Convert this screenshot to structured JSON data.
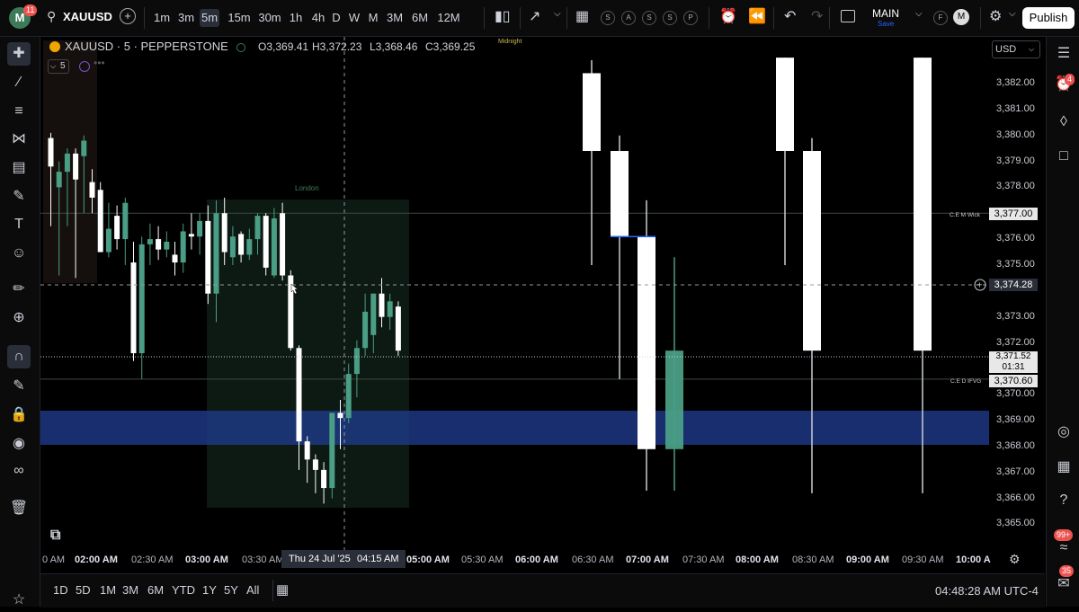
{
  "topbar": {
    "avatar_letter": "M",
    "avatar_badge": "11",
    "symbol": "XAUUSD",
    "intervals": [
      "1m",
      "3m",
      "5m",
      "15m",
      "30m",
      "1h",
      "4h",
      "D",
      "W",
      "M",
      "3M",
      "6M",
      "12M"
    ],
    "active_interval": "5m",
    "indicator_letters": [
      "S",
      "A",
      "S",
      "S",
      "P"
    ],
    "layout_name": "MAIN",
    "layout_save": "Save",
    "circle_f": "F",
    "circle_m": "M",
    "publish_label": "Publish"
  },
  "legend": {
    "title": "XAUUSD · 5 · PEPPERSTONE",
    "open": "O3,369.41",
    "high": "H3,372.23",
    "low": "L3,368.46",
    "close": "C3,369.25",
    "interval_badge": "5"
  },
  "chart": {
    "currency": "USD",
    "session_london": "London",
    "session_midnight": "Midnight",
    "marker_cem_wick": "C.E M Wick",
    "marker_ced_ifvg": "C.E D IFVG",
    "crosshair_price": "3,374.28",
    "current_price": "3,371.52",
    "countdown": "01:31",
    "level_3377": "3,377.00",
    "level_3370": "3,370.60",
    "crosshair_date": "Thu 24 Jul '25",
    "crosshair_time": "04:15 AM",
    "colors": {
      "bull": "#4a9e85",
      "bear": "#ffffff",
      "zone": "#1e3a8a"
    }
  },
  "price_axis": [
    "3,382.00",
    "3,381.00",
    "3,380.00",
    "3,379.00",
    "3,378.00",
    "3,376.00",
    "3,375.00",
    "3,373.00",
    "3,372.00",
    "3,370.00",
    "3,369.00",
    "3,368.00",
    "3,367.00",
    "3,366.00",
    "3,365.00"
  ],
  "time_axis": [
    {
      "t": "0 AM",
      "bold": false
    },
    {
      "t": "02:00 AM",
      "bold": true
    },
    {
      "t": "02:30 AM",
      "bold": false
    },
    {
      "t": "03:00 AM",
      "bold": true
    },
    {
      "t": "03:30 AM",
      "bold": false
    },
    {
      "t": "05:00 AM",
      "bold": true
    },
    {
      "t": "05:30 AM",
      "bold": false
    },
    {
      "t": "06:00 AM",
      "bold": true
    },
    {
      "t": "06:30 AM",
      "bold": false
    },
    {
      "t": "07:00 AM",
      "bold": true
    },
    {
      "t": "07:30 AM",
      "bold": false
    },
    {
      "t": "08:00 AM",
      "bold": true
    },
    {
      "t": "08:30 AM",
      "bold": false
    },
    {
      "t": "09:00 AM",
      "bold": true
    },
    {
      "t": "09:30 AM",
      "bold": false
    },
    {
      "t": "10:00 A",
      "bold": true
    }
  ],
  "bottom": {
    "ranges": [
      "1D",
      "5D",
      "1M",
      "3M",
      "6M",
      "YTD",
      "1Y",
      "5Y",
      "All"
    ],
    "clock": "04:48:28 AM UTC-4"
  },
  "rightbar": {
    "alerts_badge": "4",
    "badge_99": "99+",
    "badge_35": "35"
  },
  "candles": [
    {
      "o": 3379.9,
      "h": 3380.1,
      "l": 3376.5,
      "c": 3378.8
    },
    {
      "o": 3378.0,
      "h": 3379.0,
      "l": 3374.6,
      "c": 3378.6
    },
    {
      "o": 3378.6,
      "h": 3379.5,
      "l": 3376.5,
      "c": 3379.3
    },
    {
      "o": 3379.3,
      "h": 3379.5,
      "l": 3374.5,
      "c": 3378.3
    },
    {
      "o": 3379.2,
      "h": 3380.0,
      "l": 3377.0,
      "c": 3379.8
    },
    {
      "o": 3378.2,
      "h": 3378.7,
      "l": 3377.0,
      "c": 3377.6
    },
    {
      "o": 3377.9,
      "h": 3378.2,
      "l": 3375.5,
      "c": 3375.5
    },
    {
      "o": 3375.5,
      "h": 3377.4,
      "l": 3375.3,
      "c": 3376.4
    },
    {
      "o": 3376.9,
      "h": 3377.3,
      "l": 3375.6,
      "c": 3376.0
    },
    {
      "o": 3376.0,
      "h": 3377.6,
      "l": 3375.0,
      "c": 3377.4
    },
    {
      "o": 3375.1,
      "h": 3375.9,
      "l": 3371.3,
      "c": 3371.6
    },
    {
      "o": 3371.6,
      "h": 3376.1,
      "l": 3370.6,
      "c": 3375.8
    },
    {
      "o": 3375.8,
      "h": 3376.6,
      "l": 3375.0,
      "c": 3376.0
    },
    {
      "o": 3376.0,
      "h": 3376.5,
      "l": 3375.2,
      "c": 3375.6
    },
    {
      "o": 3375.6,
      "h": 3376.3,
      "l": 3375.3,
      "c": 3375.9
    },
    {
      "o": 3375.4,
      "h": 3375.9,
      "l": 3374.6,
      "c": 3375.1
    },
    {
      "o": 3375.1,
      "h": 3376.6,
      "l": 3374.7,
      "c": 3376.3
    },
    {
      "o": 3376.2,
      "h": 3377.0,
      "l": 3375.6,
      "c": 3376.1
    },
    {
      "o": 3376.1,
      "h": 3377.0,
      "l": 3375.4,
      "c": 3376.7
    },
    {
      "o": 3376.7,
      "h": 3377.3,
      "l": 3373.5,
      "c": 3373.9
    },
    {
      "o": 3373.9,
      "h": 3377.5,
      "l": 3372.8,
      "c": 3377.0
    },
    {
      "o": 3377.0,
      "h": 3377.6,
      "l": 3375.0,
      "c": 3375.5
    },
    {
      "o": 3375.3,
      "h": 3376.5,
      "l": 3375.0,
      "c": 3376.1
    },
    {
      "o": 3376.2,
      "h": 3376.3,
      "l": 3375.1,
      "c": 3375.4
    },
    {
      "o": 3375.4,
      "h": 3376.4,
      "l": 3375.2,
      "c": 3376.0
    },
    {
      "o": 3376.0,
      "h": 3377.0,
      "l": 3375.4,
      "c": 3376.9
    },
    {
      "o": 3376.9,
      "h": 3377.0,
      "l": 3374.6,
      "c": 3374.9
    },
    {
      "o": 3374.6,
      "h": 3377.2,
      "l": 3374.5,
      "c": 3376.8
    },
    {
      "o": 3377.0,
      "h": 3377.4,
      "l": 3374.4,
      "c": 3374.6
    },
    {
      "o": 3374.6,
      "h": 3374.8,
      "l": 3371.7,
      "c": 3371.8
    },
    {
      "o": 3371.8,
      "h": 3371.9,
      "l": 3367.1,
      "c": 3368.2
    },
    {
      "o": 3368.2,
      "h": 3368.4,
      "l": 3366.6,
      "c": 3367.5
    },
    {
      "o": 3367.5,
      "h": 3367.7,
      "l": 3366.2,
      "c": 3367.1
    },
    {
      "o": 3367.1,
      "h": 3367.4,
      "l": 3365.8,
      "c": 3366.4
    },
    {
      "o": 3366.4,
      "h": 3369.3,
      "l": 3366.0,
      "c": 3369.3
    },
    {
      "o": 3369.3,
      "h": 3369.8,
      "l": 3367.9,
      "c": 3369.1
    },
    {
      "o": 3369.1,
      "h": 3371.2,
      "l": 3368.9,
      "c": 3370.8
    },
    {
      "o": 3370.8,
      "h": 3372.1,
      "l": 3369.9,
      "c": 3371.8
    },
    {
      "o": 3371.8,
      "h": 3373.9,
      "l": 3371.5,
      "c": 3373.2
    },
    {
      "o": 3372.3,
      "h": 3373.9,
      "l": 3371.6,
      "c": 3373.9
    },
    {
      "o": 3373.9,
      "h": 3374.5,
      "l": 3372.6,
      "c": 3373.0
    },
    {
      "o": 3373.0,
      "h": 3373.9,
      "l": 3372.5,
      "c": 3373.6
    },
    {
      "o": 3373.4,
      "h": 3373.6,
      "l": 3371.5,
      "c": 3371.7
    }
  ],
  "hourly": [
    {
      "o": 3382.4,
      "h": 3382.9,
      "l": 3375.0,
      "c": 3379.4
    },
    {
      "o": 3379.4,
      "h": 3380.0,
      "l": 3370.6,
      "c": 3376.1
    },
    {
      "o": 3376.1,
      "h": 3377.5,
      "l": 3366.3,
      "c": 3367.9
    },
    {
      "o": 3367.9,
      "h": 3375.3,
      "l": 3366.3,
      "c": 3371.7
    },
    {
      "o": 3383.0,
      "h": 3383.0,
      "l": 3375.0,
      "c": 3379.4
    },
    {
      "o": 3379.4,
      "h": 3379.9,
      "l": 3366.2,
      "c": 3371.7
    },
    {
      "o": 3383.0,
      "h": 3383.0,
      "l": 3366.2,
      "c": 3371.7
    }
  ]
}
